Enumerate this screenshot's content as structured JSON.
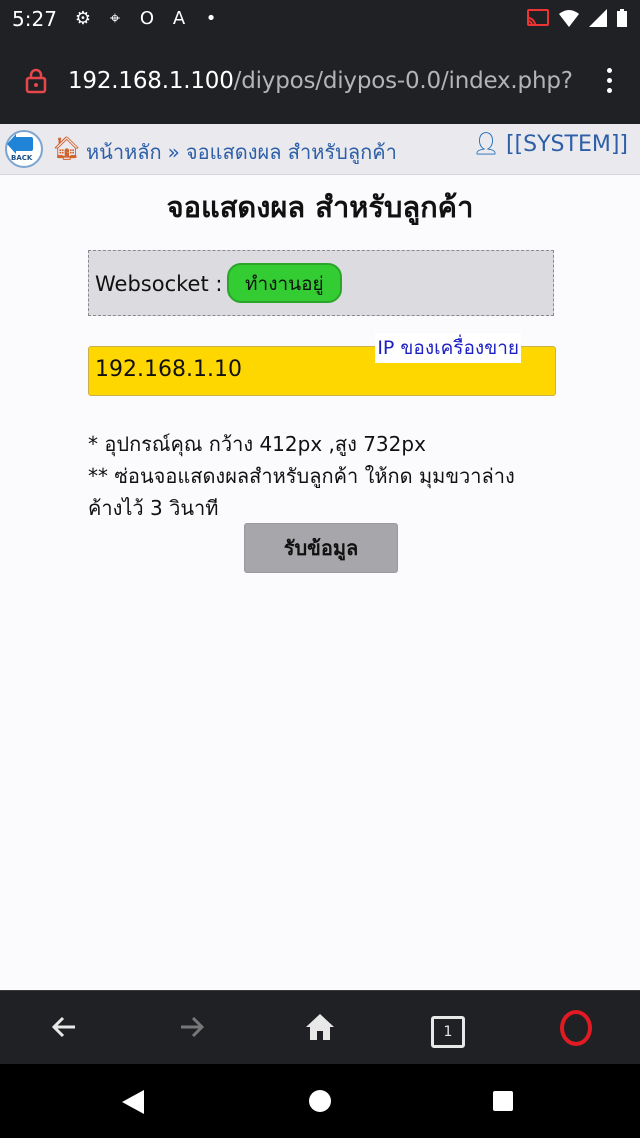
{
  "status_bar": {
    "time": "5:27",
    "left_icons": [
      "gear-icon",
      "map-icon",
      "opera-icon",
      "text-icon",
      "dot-icon"
    ],
    "right_icons": [
      "cast-icon",
      "wifi-icon",
      "signal-icon",
      "battery-icon"
    ]
  },
  "address_bar": {
    "host": "192.168.1.100",
    "path": "/diypos/diypos-0.0/index.php?"
  },
  "header": {
    "back_label": "BACK",
    "home_label": "หน้าหลัก",
    "separator": "»",
    "current_page": "จอแสดงผล สำหรับลูกค้า",
    "user": "[[SYSTEM]]"
  },
  "main": {
    "title": "จอแสดงผล สำหรับลูกค้า",
    "websocket_label": "Websocket :",
    "websocket_status": "ทำงานอยู่",
    "ip_value": "192.168.1.10",
    "ip_caption": "IP ของเครื่องขาย",
    "note_1": "* อุปกรณ์คุณ กว้าง 412px ,สูง 732px",
    "note_2": "** ซ่อนจอแสดงผลสำหรับลูกค้า ให้กด มุมขวาล่าง ค้างไว้ 3 วินาที",
    "button_label": "รับข้อมูล"
  },
  "browser_nav": {
    "tab_count": "1"
  },
  "colors": {
    "websocket_active": "#33cc33",
    "ip_field": "#ffd700",
    "link": "#2d5fa8"
  }
}
